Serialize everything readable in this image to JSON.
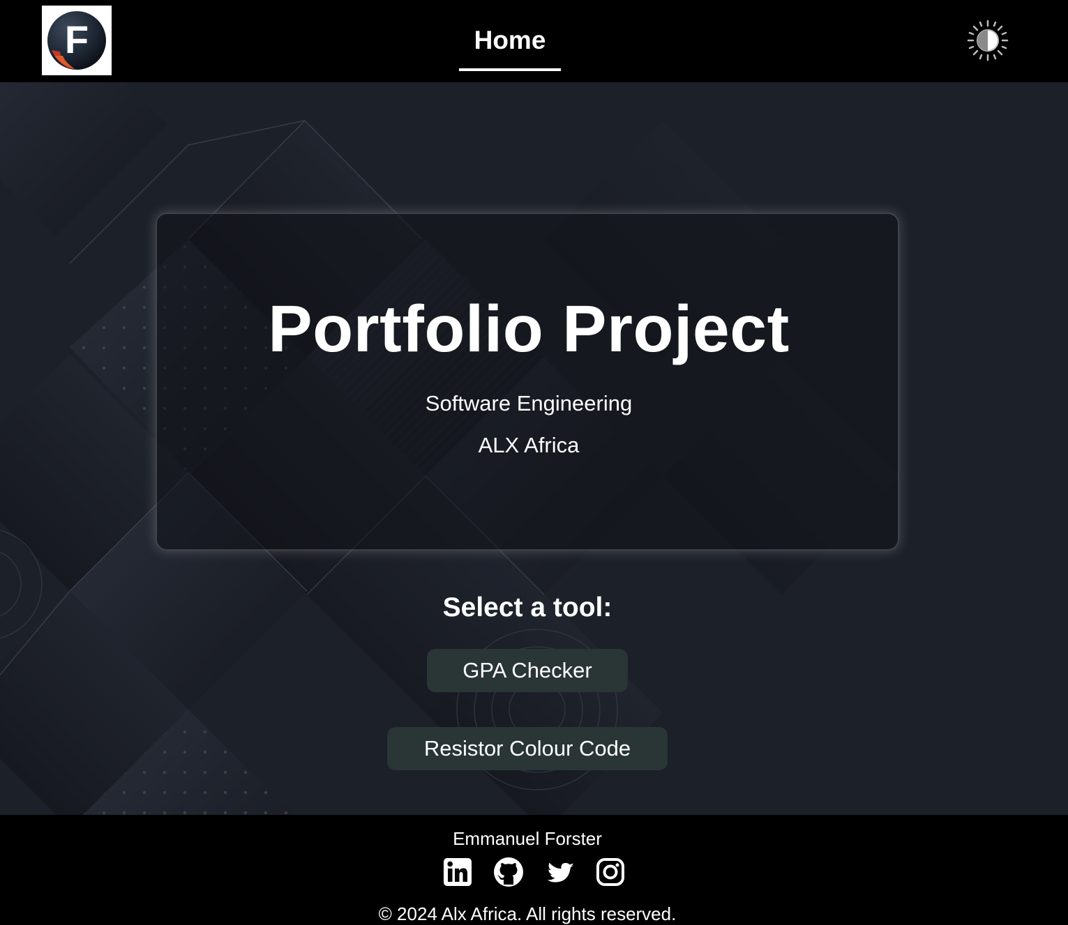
{
  "header": {
    "logo_letter": "F",
    "nav": {
      "home_label": "Home"
    }
  },
  "hero": {
    "title": "Portfolio Project",
    "subtitle_1": "Software Engineering",
    "subtitle_2": "ALX Africa"
  },
  "tools": {
    "heading": "Select a tool:",
    "buttons": [
      {
        "label": "GPA Checker"
      },
      {
        "label": "Resistor Colour Code"
      }
    ]
  },
  "footer": {
    "name": "Emmanuel Forster",
    "social_icons": [
      "linkedin-icon",
      "github-icon",
      "twitter-icon",
      "instagram-icon"
    ],
    "copyright": "© 2024 Alx Africa. All rights reserved."
  },
  "colors": {
    "header_bg": "#000000",
    "main_bg": "#1b1f29",
    "button_bg": "#2a3535",
    "text": "#ffffff"
  }
}
